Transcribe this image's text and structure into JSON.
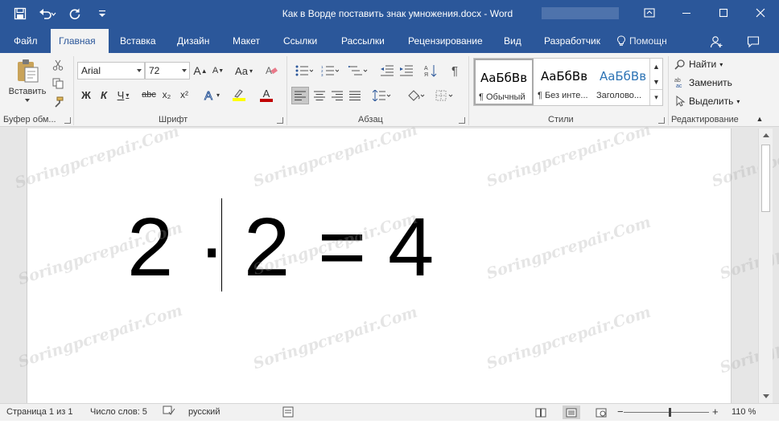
{
  "window": {
    "title": "Как в Ворде поставить знак умножения.docx - Word"
  },
  "quick_access": [
    "save-icon",
    "undo-icon",
    "redo-icon",
    "customize-qat-icon"
  ],
  "tabs": [
    {
      "label": "Файл",
      "active": false
    },
    {
      "label": "Главная",
      "active": true
    },
    {
      "label": "Вставка",
      "active": false
    },
    {
      "label": "Дизайн",
      "active": false
    },
    {
      "label": "Макет",
      "active": false
    },
    {
      "label": "Ссылки",
      "active": false
    },
    {
      "label": "Рассылки",
      "active": false
    },
    {
      "label": "Рецензирование",
      "active": false
    },
    {
      "label": "Вид",
      "active": false
    },
    {
      "label": "Разработчик",
      "active": false
    }
  ],
  "help": {
    "label": "Помощн"
  },
  "ribbon": {
    "clipboard": {
      "paste_label": "Вставить",
      "group_label": "Буфер обм..."
    },
    "font": {
      "name": "Arial",
      "size": "72",
      "group_label": "Шрифт",
      "bold": "Ж",
      "italic": "К",
      "underline": "Ч",
      "strike": "abc",
      "subscript": "x₂",
      "superscript": "x²",
      "grow": "A",
      "shrink": "A",
      "case": "Aa",
      "highlight_color": "#ffff00",
      "font_color": "#c00000"
    },
    "paragraph": {
      "group_label": "Абзац"
    },
    "styles": {
      "group_label": "Стили",
      "items": [
        {
          "preview": "АаБбВв",
          "name": "¶ Обычный",
          "selected": true,
          "color": "#000000"
        },
        {
          "preview": "АаБбВв",
          "name": "¶ Без инте...",
          "selected": false,
          "color": "#000000"
        },
        {
          "preview": "АаБбВв",
          "name": "Заголово...",
          "selected": false,
          "color": "#2e74b5"
        }
      ]
    },
    "editing": {
      "group_label": "Редактирование",
      "find": "Найти",
      "replace": "Заменить",
      "select": "Выделить"
    }
  },
  "document": {
    "formula": {
      "a": "2",
      "op": "·",
      "b": "2",
      "eq": "=",
      "result": "4"
    },
    "watermark": "Soringpcrepair.Com"
  },
  "status": {
    "page": "Страница 1 из 1",
    "words": "Число слов: 5",
    "language": "русский",
    "zoom": "110 %"
  },
  "colors": {
    "accent": "#2b579a",
    "ribbon_bg": "#f3f3f3"
  }
}
